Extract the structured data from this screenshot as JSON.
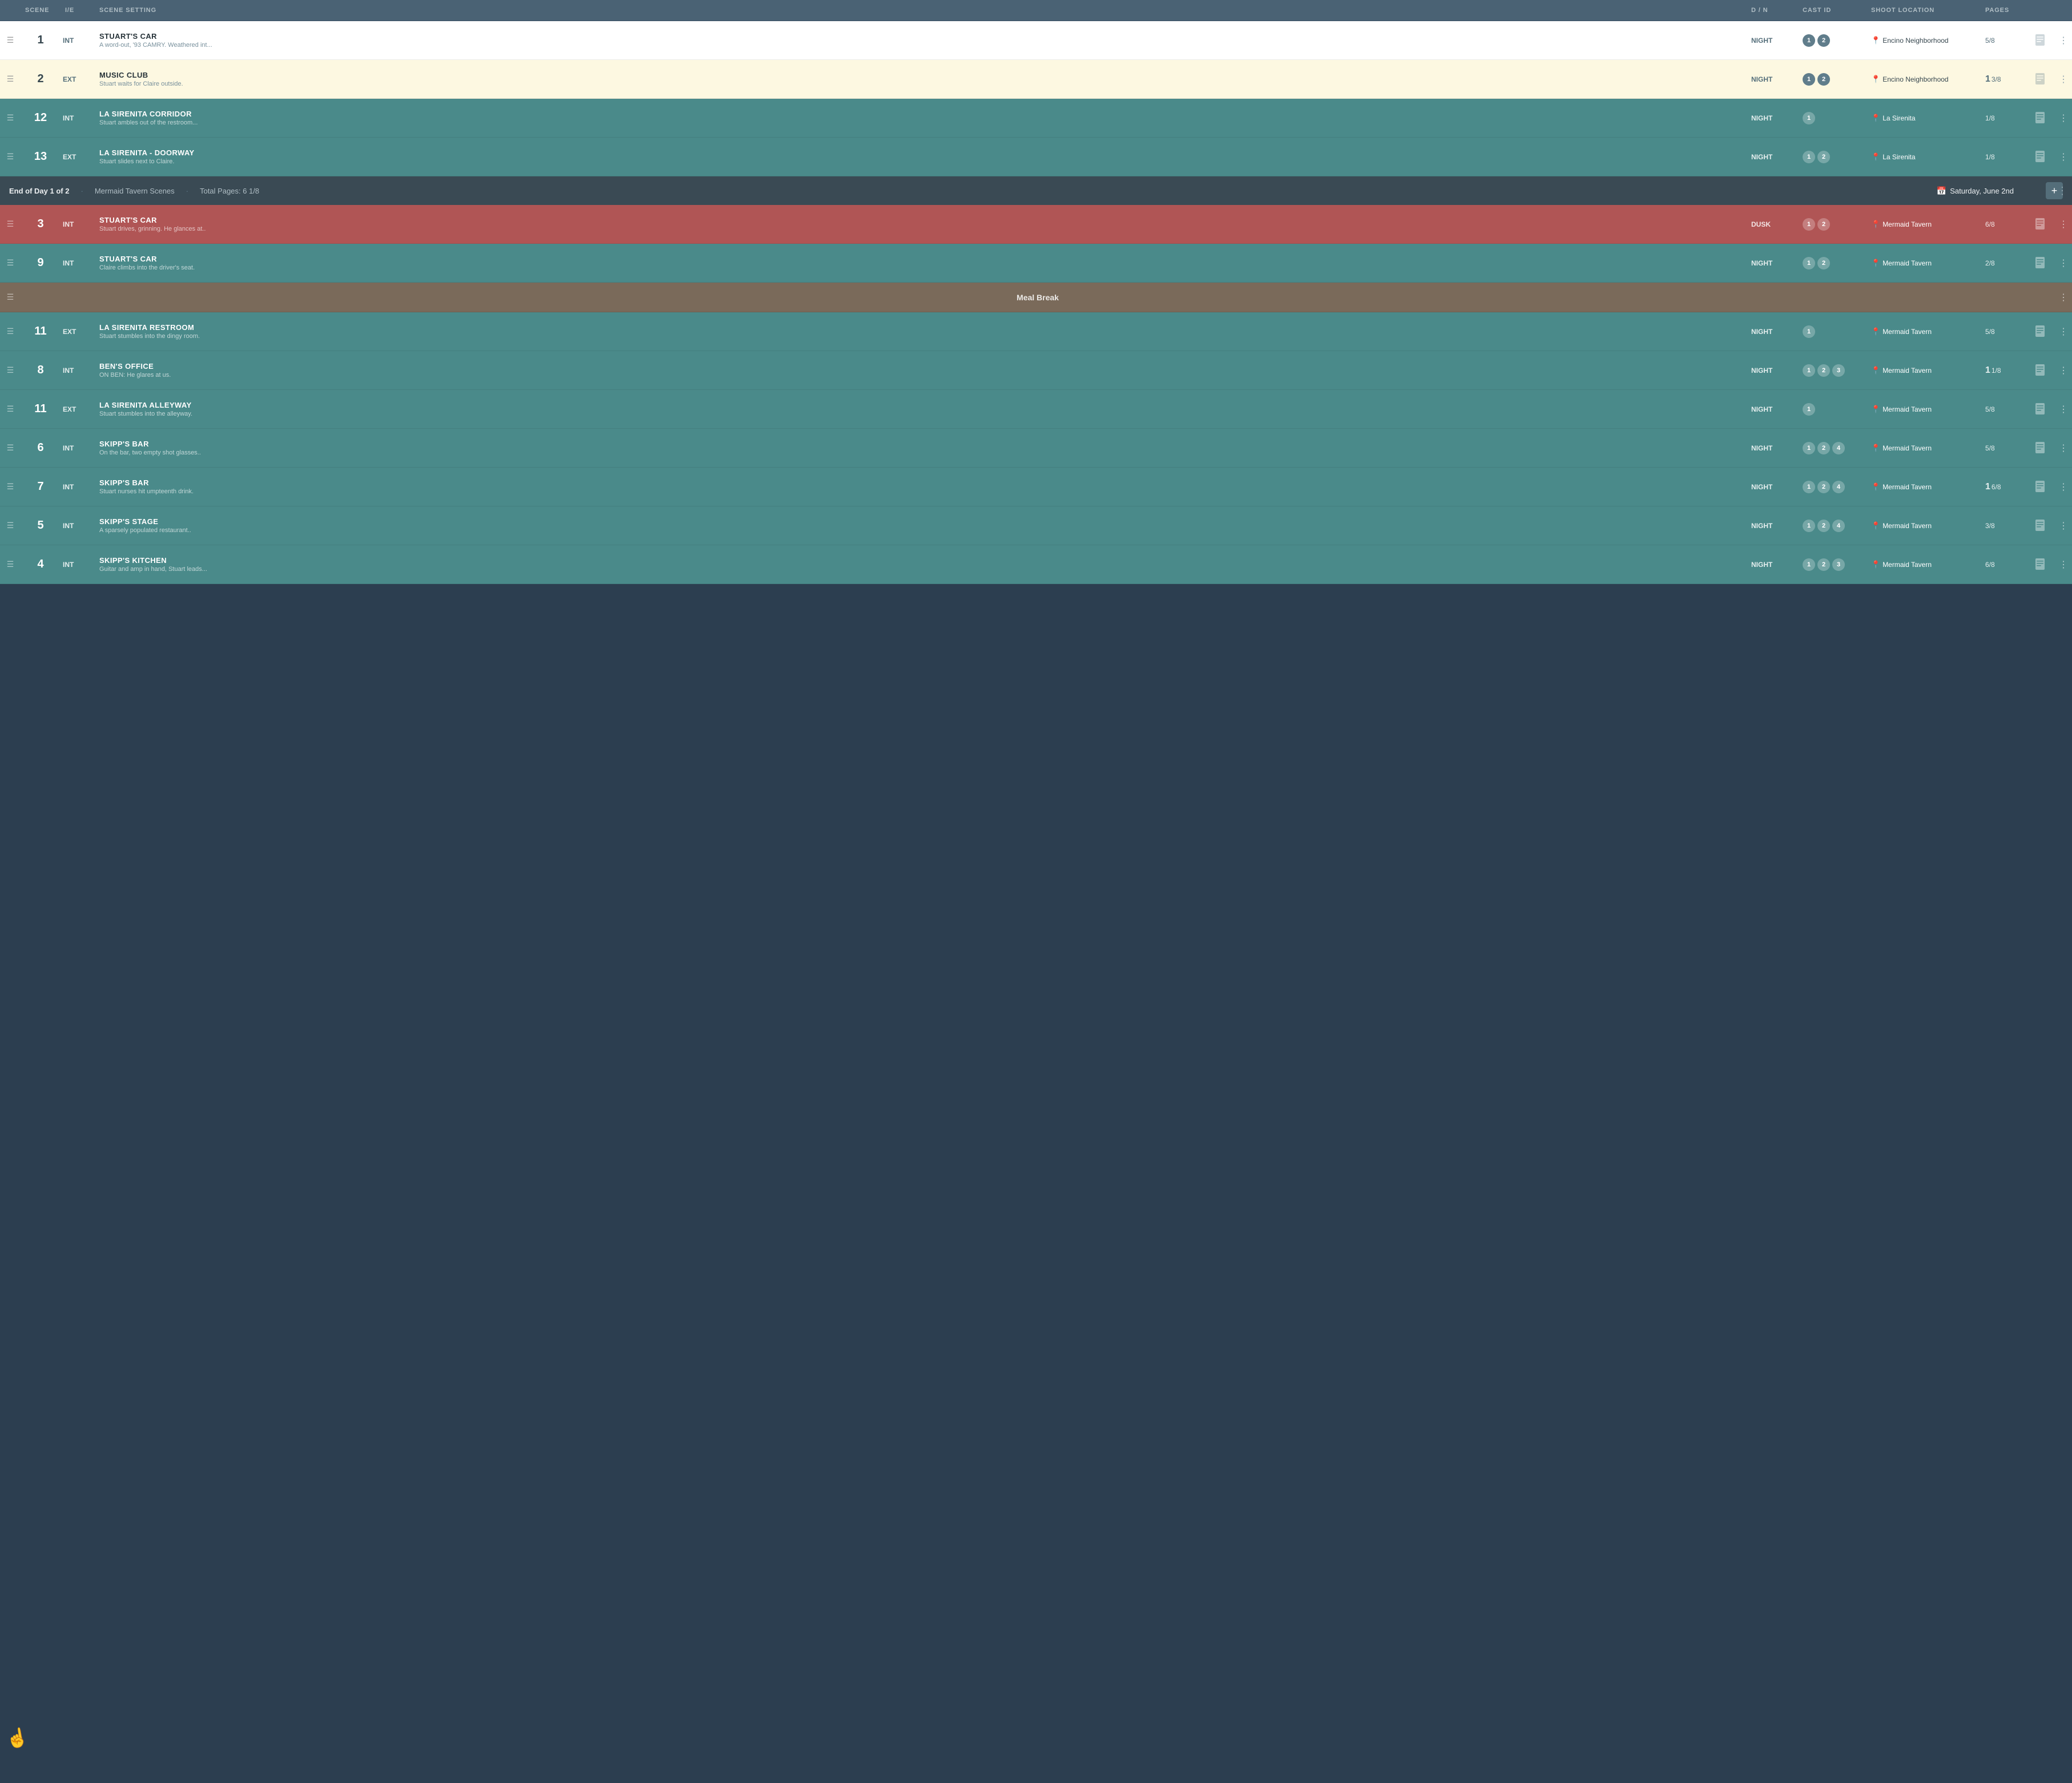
{
  "header": {
    "cols": [
      "",
      "SCENE",
      "I/E",
      "SCENE SETTING",
      "D / N",
      "CAST ID",
      "SHOOT LOCATION",
      "PAGES",
      "",
      ""
    ]
  },
  "rows": [
    {
      "id": "row-1",
      "type": "scene",
      "colorClass": "row-light",
      "scene": "1",
      "ie": "INT",
      "title": "STUART'S CAR",
      "sub": "A word-out, '93 CAMRY. Weathered int...",
      "dn": "NIGHT",
      "cast": [
        "1",
        "2"
      ],
      "location": "Encino Neighborhood",
      "pages": "5/8",
      "pagesMain": "",
      "theme": "light"
    },
    {
      "id": "row-2",
      "type": "scene",
      "colorClass": "row-yellow",
      "scene": "2",
      "ie": "EXT",
      "title": "MUSIC CLUB",
      "sub": "Stuart waits for Claire outside.",
      "dn": "NIGHT",
      "cast": [
        "1",
        "2"
      ],
      "location": "Encino Neighborhood",
      "pages": "3/8",
      "pagesMain": "1",
      "theme": "light"
    },
    {
      "id": "row-12",
      "type": "scene",
      "colorClass": "row-teal",
      "scene": "12",
      "ie": "INT",
      "title": "LA SIRENITA CORRIDOR",
      "sub": "Stuart ambles out of the restroom...",
      "dn": "NIGHT",
      "cast": [
        "1"
      ],
      "location": "La Sirenita",
      "pages": "1/8",
      "pagesMain": "",
      "theme": "teal"
    },
    {
      "id": "row-13",
      "type": "scene",
      "colorClass": "row-teal",
      "scene": "13",
      "ie": "EXT",
      "title": "LA SIRENITA - DOORWAY",
      "sub": "Stuart slides next to Claire.",
      "dn": "NIGHT",
      "cast": [
        "1",
        "2"
      ],
      "location": "La Sirenita",
      "pages": "1/8",
      "pagesMain": "",
      "theme": "teal"
    }
  ],
  "dayBreak": {
    "text": "End of Day 1 of 2",
    "scenes": "Mermaid Tavern Scenes",
    "totalPages": "Total Pages: 6 1/8",
    "date": "Saturday, June 2nd",
    "addLabel": "+",
    "moreLabel": "⋮"
  },
  "rows2": [
    {
      "id": "row-3",
      "type": "scene",
      "colorClass": "row-red",
      "scene": "3",
      "ie": "INT",
      "title": "STUART'S CAR",
      "sub": "Stuart drives, grinning. He glances at..",
      "dn": "DUSK",
      "cast": [
        "1",
        "2"
      ],
      "location": "Mermaid Tavern",
      "pages": "6/8",
      "pagesMain": "",
      "theme": "red"
    },
    {
      "id": "row-9",
      "type": "scene",
      "colorClass": "row-teal",
      "scene": "9",
      "ie": "INT",
      "title": "STUART'S CAR",
      "sub": "Claire climbs into the driver's seat.",
      "dn": "NIGHT",
      "cast": [
        "1",
        "2"
      ],
      "location": "Mermaid Tavern",
      "pages": "2/8",
      "pagesMain": "",
      "theme": "teal"
    }
  ],
  "mealBreak": {
    "text": "Meal Break"
  },
  "rows3": [
    {
      "id": "row-11a",
      "type": "scene",
      "colorClass": "row-teal",
      "scene": "11",
      "ie": "EXT",
      "title": "LA SIRENITA RESTROOM",
      "sub": "Stuart stumbles into the dingy room.",
      "dn": "NIGHT",
      "cast": [
        "1"
      ],
      "location": "Mermaid Tavern",
      "pages": "5/8",
      "pagesMain": "",
      "theme": "teal"
    },
    {
      "id": "row-8",
      "type": "scene",
      "colorClass": "row-teal",
      "scene": "8",
      "ie": "INT",
      "title": "BEN'S OFFICE",
      "sub": "ON BEN: He glares at us.",
      "dn": "NIGHT",
      "cast": [
        "1",
        "2",
        "3"
      ],
      "location": "Mermaid Tavern",
      "pages": "1/8",
      "pagesMain": "1",
      "theme": "teal"
    },
    {
      "id": "row-11b",
      "type": "scene",
      "colorClass": "row-teal",
      "scene": "11",
      "ie": "EXT",
      "title": "LA SIRENITA ALLEYWAY",
      "sub": "Stuart stumbles into the alleyway.",
      "dn": "NIGHT",
      "cast": [
        "1"
      ],
      "location": "Mermaid Tavern",
      "pages": "5/8",
      "pagesMain": "",
      "theme": "teal"
    },
    {
      "id": "row-6",
      "type": "scene",
      "colorClass": "row-teal",
      "scene": "6",
      "ie": "INT",
      "title": "SKIPP'S BAR",
      "sub": "On the bar, two empty shot glasses..",
      "dn": "NIGHT",
      "cast": [
        "1",
        "2",
        "4"
      ],
      "location": "Mermaid Tavern",
      "pages": "5/8",
      "pagesMain": "",
      "theme": "teal"
    },
    {
      "id": "row-7",
      "type": "scene",
      "colorClass": "row-teal",
      "scene": "7",
      "ie": "INT",
      "title": "SKIPP'S BAR",
      "sub": "Stuart nurses hit umpteenth drink.",
      "dn": "NIGHT",
      "cast": [
        "1",
        "2",
        "4"
      ],
      "location": "Mermaid Tavern",
      "pages": "6/8",
      "pagesMain": "1",
      "theme": "teal"
    },
    {
      "id": "row-5",
      "type": "scene",
      "colorClass": "row-teal",
      "scene": "5",
      "ie": "INT",
      "title": "SKIPP'S STAGE",
      "sub": "A sparsely populated restaurant..",
      "dn": "NIGHT",
      "cast": [
        "1",
        "2",
        "4"
      ],
      "location": "Mermaid Tavern",
      "pages": "3/8",
      "pagesMain": "",
      "theme": "teal"
    },
    {
      "id": "row-4",
      "type": "scene",
      "colorClass": "row-teal",
      "scene": "4",
      "ie": "INT",
      "title": "SKIPP'S KITCHEN",
      "sub": "Guitar and amp in hand, Stuart leads...",
      "dn": "NIGHT",
      "cast": [
        "1",
        "2",
        "3"
      ],
      "location": "Mermaid Tavern",
      "pages": "6/8",
      "pagesMain": "",
      "theme": "teal"
    }
  ]
}
